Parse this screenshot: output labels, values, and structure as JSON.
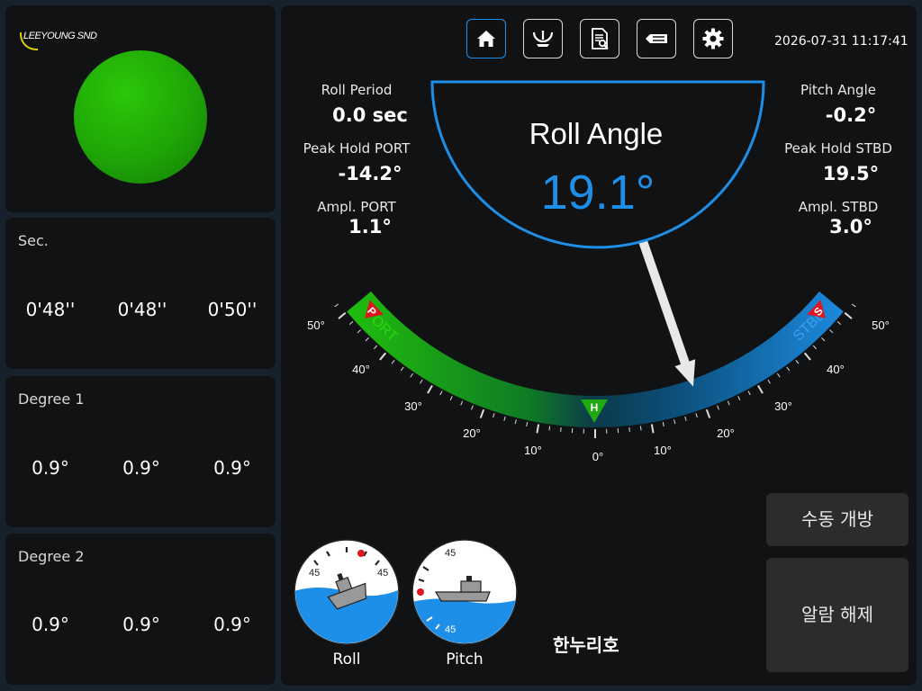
{
  "brand": {
    "logo_text": "LEEYOUNG SND"
  },
  "status_lamp": {
    "color": "#1ea506"
  },
  "cards": {
    "sec": {
      "title": "Sec.",
      "values": [
        "0'48''",
        "0'48''",
        "0'50''"
      ]
    },
    "degree1": {
      "title": "Degree 1",
      "values": [
        "0.9°",
        "0.9°",
        "0.9°"
      ]
    },
    "degree2": {
      "title": "Degree 2",
      "values": [
        "0.9°",
        "0.9°",
        "0.9°"
      ]
    }
  },
  "toolbar": {
    "buttons": [
      {
        "icon": "home-icon",
        "active": true
      },
      {
        "icon": "roll-gauge-icon",
        "active": false
      },
      {
        "icon": "report-search-icon",
        "active": false
      },
      {
        "icon": "ship-icon",
        "active": false
      },
      {
        "icon": "gear-icon",
        "active": false
      }
    ]
  },
  "datetime": "2026-07-31 11:17:41",
  "left_readouts": {
    "roll_period_label": "Roll Period",
    "roll_period_value": "0.0 sec",
    "peak_port_label": "Peak Hold PORT",
    "peak_port_value": "-14.2°",
    "ampl_port_label": "Ampl. PORT",
    "ampl_port_value": "1.1°"
  },
  "right_readouts": {
    "pitch_label": "Pitch Angle",
    "pitch_value": "-0.2°",
    "peak_stbd_label": "Peak Hold STBD",
    "peak_stbd_value": "19.5°",
    "ampl_stbd_label": "Ampl. STBD",
    "ampl_stbd_value": "3.0°"
  },
  "roll_display": {
    "title": "Roll Angle",
    "value": "19.1°",
    "angle_deg": 19.1,
    "value_color": "#1e8fe8"
  },
  "scale": {
    "port_label": "PORT",
    "stbd_label": "STBD",
    "port_color": "#21c40a",
    "stbd_color": "#1e8fe8",
    "port_marker": "P",
    "stbd_marker": "S",
    "home_marker": "H",
    "port_peak_deg": -14.2,
    "stbd_peak_deg": 19.5,
    "tick_labels_left": [
      "50°",
      "40°",
      "30°",
      "20°",
      "10°"
    ],
    "tick_label_zero": "0°",
    "tick_labels_right": [
      "10°",
      "20°",
      "30°",
      "40°",
      "50°"
    ]
  },
  "mini_gauges": {
    "roll": {
      "label": "Roll",
      "scale_left": "45",
      "scale_right": "45"
    },
    "pitch": {
      "label": "Pitch",
      "scale_top": "45",
      "scale_bottom": "45"
    }
  },
  "ship_name": "한누리호",
  "actions": {
    "manual_open": "수동 개방",
    "alarm_clear": "알람 해제"
  }
}
